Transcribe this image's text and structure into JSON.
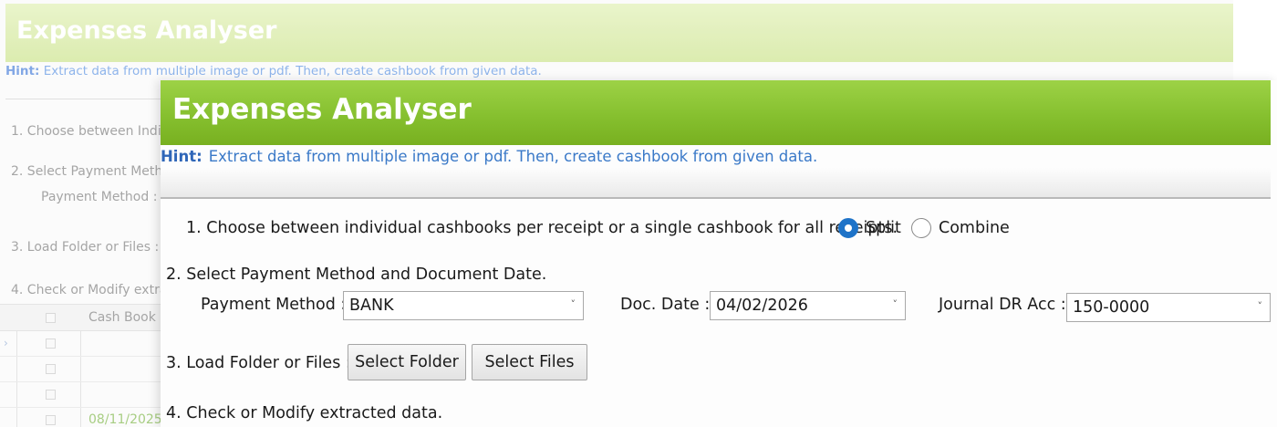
{
  "background_window": {
    "title": "Expenses Analyser",
    "hint_label": "Hint:",
    "hint_text": "Extract data from multiple image or pdf. Then, create cashbook from given data.",
    "step1": "1. Choose between Indiv",
    "step2": "2. Select Payment Metho",
    "payment_method_label": "Payment Method :",
    "step3": "3. Load Folder or Files :",
    "step4": "4. Check or Modify extra",
    "grid": {
      "column_header": "Cash Book",
      "row_marker": "›",
      "rows": [
        "",
        "",
        "",
        "08/11/2025"
      ]
    }
  },
  "window": {
    "title": "Expenses Analyser",
    "hint_label": "Hint:",
    "hint_text": "Extract data from multiple image or pdf. Then, create cashbook from given data.",
    "step1": {
      "text": "1. Choose between individual cashbooks per receipt or a single cashbook for all receipts.",
      "options": [
        {
          "label": "Split",
          "selected": true
        },
        {
          "label": "Combine",
          "selected": false
        }
      ]
    },
    "step2": {
      "text": "2. Select Payment Method and Document Date.",
      "payment_method": {
        "label": "Payment Method :",
        "value": "BANK",
        "caret": "˅"
      },
      "doc_date": {
        "label": "Doc. Date :",
        "value": "04/02/2026",
        "caret": "˅"
      },
      "journal_dr_acc": {
        "label": "Journal DR Acc :",
        "value": "150-0000",
        "caret": "˅"
      }
    },
    "step3": {
      "text": "3. Load Folder or Files :",
      "select_folder": "Select Folder",
      "select_files": "Select Files"
    },
    "step4": {
      "text": "4. Check or Modify extracted data."
    }
  },
  "colors": {
    "title_bar": "#86c02f",
    "hint_text": "#3a79c8",
    "radio_selected": "#1e73c8",
    "date_text": "#8fc060"
  }
}
